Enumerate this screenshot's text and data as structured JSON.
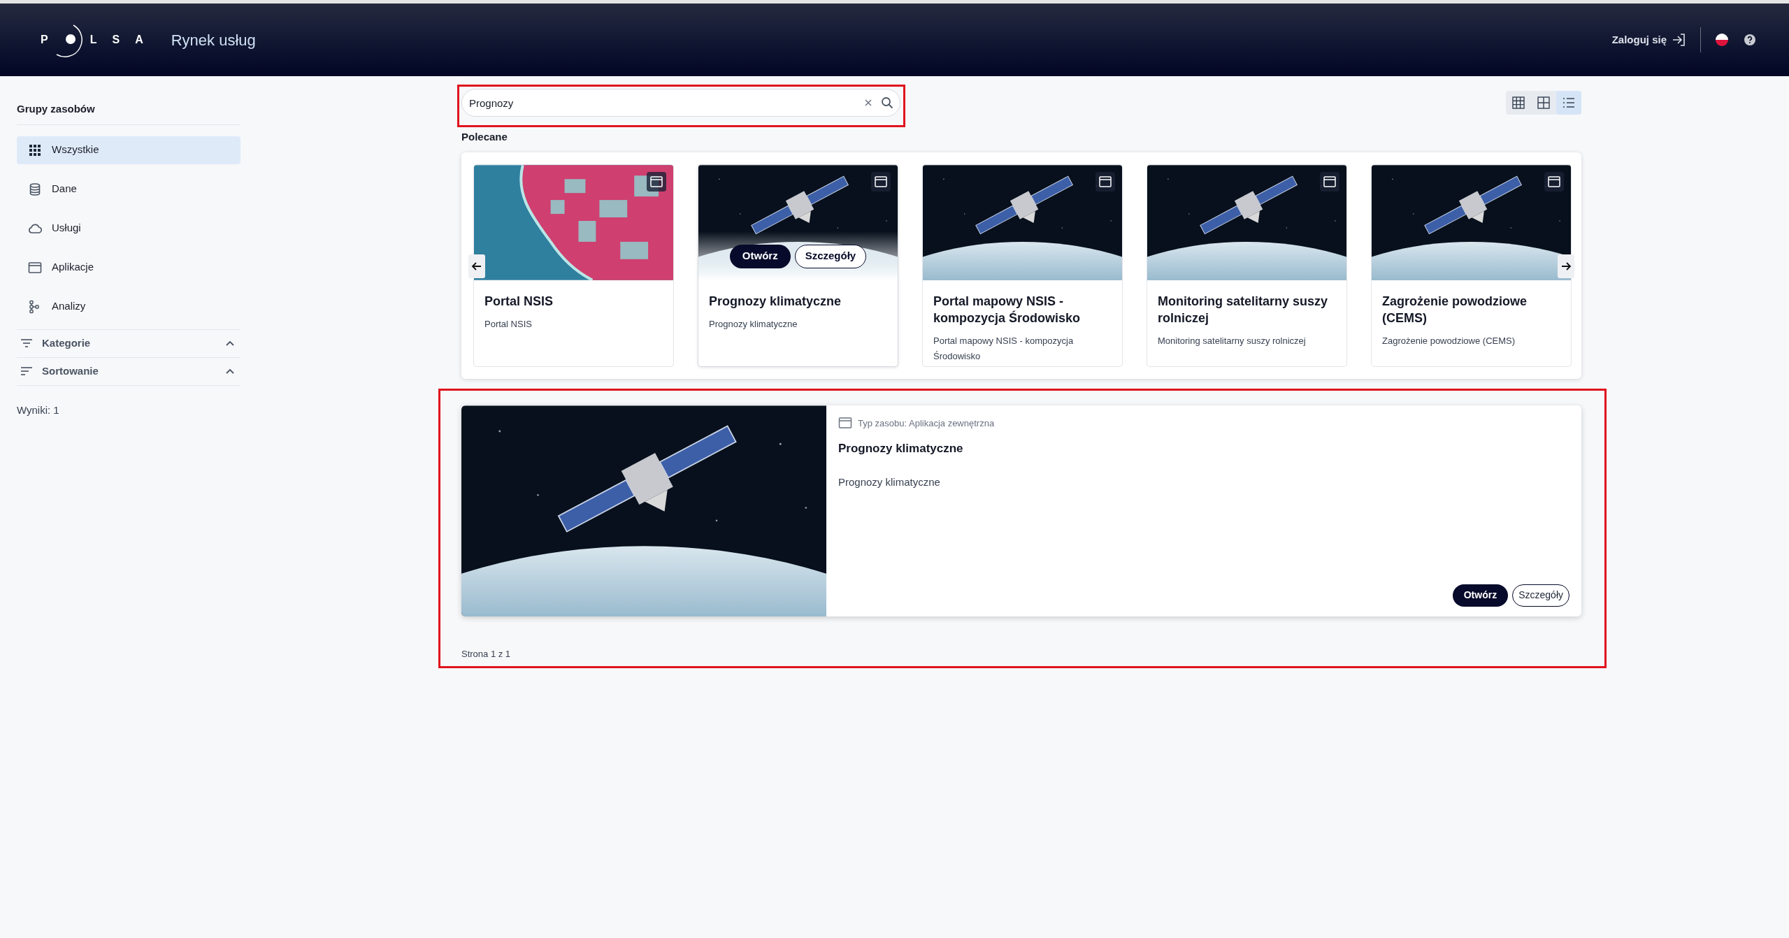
{
  "header": {
    "logo_letters": [
      "P",
      "L",
      "S",
      "A"
    ],
    "app_title": "Rynek usług",
    "login": "Zaloguj się"
  },
  "sidebar": {
    "heading": "Grupy zasobów",
    "groups": [
      {
        "label": "Wszystkie",
        "kind": "all",
        "selected": true
      },
      {
        "label": "Dane",
        "kind": "data",
        "selected": false
      },
      {
        "label": "Usługi",
        "kind": "services",
        "selected": false
      },
      {
        "label": "Aplikacje",
        "kind": "apps",
        "selected": false
      },
      {
        "label": "Analizy",
        "kind": "analyses",
        "selected": false
      }
    ],
    "filters": [
      {
        "label": "Kategorie",
        "kind": "filter"
      },
      {
        "label": "Sortowanie",
        "kind": "sort"
      }
    ],
    "results_count": "Wyniki: 1"
  },
  "search": {
    "value": "Prognozy"
  },
  "view_modes": [
    {
      "kind": "grid-small",
      "selected": false
    },
    {
      "kind": "grid-large",
      "selected": false
    },
    {
      "kind": "list",
      "selected": true
    }
  ],
  "featured": {
    "title": "Polecane",
    "cards": [
      {
        "title": "Portal NSIS",
        "description": "Portal NSIS",
        "kind": "aerial",
        "hovered": false
      },
      {
        "title": "Prognozy klimatyczne",
        "description": "Prognozy klimatyczne",
        "kind": "satellite",
        "hovered": true,
        "actions": [
          "Otwórz",
          "Szczegóły"
        ]
      },
      {
        "title": "Portal mapowy NSIS - kompozycja Środowisko",
        "description": "Portal mapowy NSIS - kompozycja Środowisko",
        "kind": "satellite",
        "hovered": false
      },
      {
        "title": "Monitoring satelitarny suszy rolniczej",
        "description": "Monitoring satelitarny suszy rolniczej",
        "kind": "satellite",
        "hovered": false
      },
      {
        "title": "Zagrożenie powodziowe (CEMS)",
        "description": "Zagrożenie powodziowe (CEMS)",
        "kind": "satellite",
        "hovered": false
      }
    ]
  },
  "results": [
    {
      "type_label": "Typ zasobu: Aplikacja zewnętrzna",
      "title": "Prognozy klimatyczne",
      "description": "Prognozy klimatyczne",
      "kind": "satellite",
      "actions": [
        "Otwórz",
        "Szczegóły"
      ]
    }
  ],
  "pagination": "Strona 1 z 1"
}
